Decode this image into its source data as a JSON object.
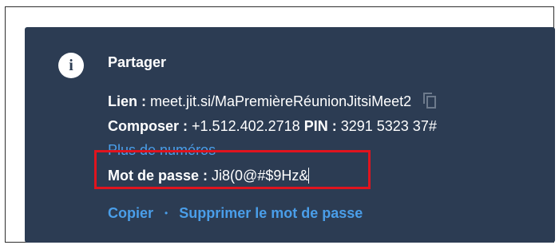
{
  "dialog": {
    "title": "Partager",
    "info_icon": "info-icon",
    "link": {
      "label": "Lien :",
      "value": "meet.jit.si/MaPremièreRéunionJitsiMeet2",
      "copy_icon": "copy-icon"
    },
    "dial_in": {
      "label": "Composer :",
      "number": "+1.512.402.2718",
      "pin_label": "PIN :",
      "pin": "3291 5323 37#"
    },
    "more_numbers": "Plus de numéros",
    "password": {
      "label": "Mot de passe :",
      "value": "Ji8(0@#$9Hz&"
    },
    "actions": {
      "copy": "Copier",
      "separator": "•",
      "remove_password": "Supprimer le mot de passe"
    }
  },
  "colors": {
    "panel_bg": "#2c3c53",
    "link": "#4a9ee9",
    "highlight": "#e0141e",
    "text": "#ffffff"
  }
}
